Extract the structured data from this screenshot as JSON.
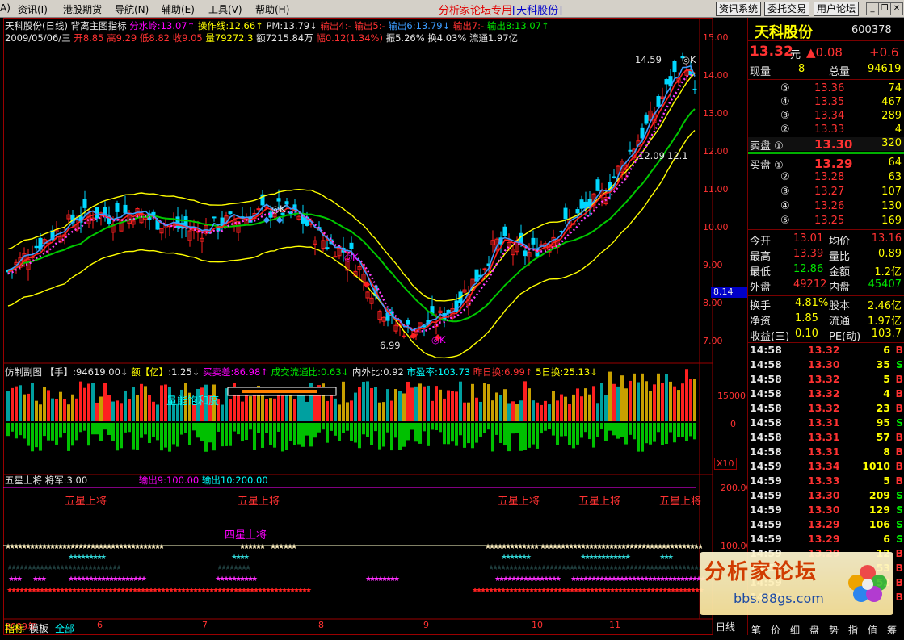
{
  "menu": {
    "items": [
      "A)",
      "资讯(I)",
      "港股期货",
      "导航(N)",
      "辅助(E)",
      "工具(V)",
      "帮助(H)"
    ],
    "banner_prefix": "分析家论坛专用",
    "banner_stock": "[天科股份]",
    "buttons": [
      "资讯系统",
      "委托交易",
      "用户论坛"
    ]
  },
  "header": {
    "line1_name": "天科股份(日线)",
    "line1_indicator": "背离主图指标",
    "fsl": "分水岭:13.07↑",
    "czx": "操作线:12.66↑",
    "pm": "PM:13.79↓",
    "sc4": "输出4:-",
    "sc5": "输出5:-",
    "sc6": "输出6:13.79↓",
    "sc7": "输出7:-",
    "sc8": "输出8:13.07↑",
    "line2_date": "2009/05/06/三",
    "open": "开8.85",
    "high": "高9.29",
    "low": "低8.82",
    "close": "收9.05",
    "vol": "量79272.3",
    "amt": "额7215.84万",
    "chg": "幅0.12(1.34%)",
    "amp": "振5.26%",
    "turn": "换4.03%",
    "float": "流通1.97亿"
  },
  "main_axis": [
    "15.00",
    "14.00",
    "13.00",
    "12.00",
    "11.00",
    "10.00",
    "9.00",
    "8.00",
    "7.00"
  ],
  "cursor_price": "8.14",
  "annotations": {
    "high_label": "14.59",
    "low_label": "6.99",
    "mid_label": "12.09",
    "mid_label2": "12.1",
    "ok1": "◎K",
    "ok2": "◎K",
    "ok3": "◎K",
    "ok4": "◎K"
  },
  "sub1": {
    "title": "仿制副图",
    "hand": "【手】:94619.00↓",
    "e_label": "额【亿】",
    "e_val": ":1.25↓",
    "buysell": "买卖差:86.98↑",
    "ratio": "成交流通比:0.63↓",
    "inout": "内外比:0.92",
    "pe": "市盈率:103.73",
    "prev": "昨日换:6.99↑",
    "five": "5日换:25.13↓",
    "floating": "量能饱和度",
    "axis": [
      "15000",
      "0"
    ],
    "x10": "X10"
  },
  "sub2": {
    "title": "五星上将",
    "jj": "将军:3.00",
    "o9": "输出9:100.00",
    "o10": "输出10:200.00",
    "wx": "五星上将",
    "sx": "四星上将",
    "axis": [
      "200.00",
      "100.00"
    ]
  },
  "x_axis": [
    "2009年",
    "6",
    "7",
    "8",
    "9",
    "10",
    "11"
  ],
  "day_label": "日线",
  "bottom_tabs": [
    "指标",
    "模板",
    "全部"
  ],
  "panel": {
    "name": "天科股份",
    "code": "600378",
    "price": "13.32",
    "unit": "元",
    "chg": "▲0.08",
    "chg_pct": "+0.6",
    "xl_label": "现量",
    "xl_val": "8",
    "zl_label": "总量",
    "zl_val": "94619",
    "asks": [
      {
        "lv": "⑤",
        "p": "13.36",
        "v": "74"
      },
      {
        "lv": "④",
        "p": "13.35",
        "v": "467"
      },
      {
        "lv": "③",
        "p": "13.34",
        "v": "289"
      },
      {
        "lv": "②",
        "p": "13.33",
        "v": "4"
      },
      {
        "lv": "卖盘 ①",
        "p": "13.30",
        "v": "320"
      }
    ],
    "bids": [
      {
        "lv": "买盘 ①",
        "p": "13.29",
        "v": "64"
      },
      {
        "lv": "②",
        "p": "13.28",
        "v": "63"
      },
      {
        "lv": "③",
        "p": "13.27",
        "v": "107"
      },
      {
        "lv": "④",
        "p": "13.26",
        "v": "130"
      },
      {
        "lv": "⑤",
        "p": "13.25",
        "v": "169"
      }
    ],
    "stats": [
      {
        "l1": "今开",
        "v1": "13.01",
        "l2": "均价",
        "v2": "13.16"
      },
      {
        "l1": "最高",
        "v1": "13.39",
        "l2": "量比",
        "v2": "0.89"
      },
      {
        "l1": "最低",
        "v1": "12.86",
        "l2": "金额",
        "v2": "1.2亿"
      },
      {
        "l1": "外盘",
        "v1": "49212",
        "l2": "内盘",
        "v2": "45407"
      }
    ],
    "fund": [
      {
        "l1": "换手",
        "v1": "4.81%",
        "l2": "股本",
        "v2": "2.46亿"
      },
      {
        "l1": "净资",
        "v1": "1.85",
        "l2": "流通",
        "v2": "1.97亿"
      },
      {
        "l1": "收益(三)",
        "v1": "0.10",
        "l2": "PE(动)",
        "v2": "103.7"
      }
    ],
    "ticks": [
      {
        "t": "14:58",
        "p": "13.32",
        "v": "6",
        "d": "B"
      },
      {
        "t": "14:58",
        "p": "13.30",
        "v": "35",
        "d": "S"
      },
      {
        "t": "14:58",
        "p": "13.32",
        "v": "5",
        "d": "B"
      },
      {
        "t": "14:58",
        "p": "13.32",
        "v": "4",
        "d": "B"
      },
      {
        "t": "14:58",
        "p": "13.32",
        "v": "23",
        "d": "B"
      },
      {
        "t": "14:58",
        "p": "13.31",
        "v": "95",
        "d": "S"
      },
      {
        "t": "14:58",
        "p": "13.31",
        "v": "57",
        "d": "B"
      },
      {
        "t": "14:58",
        "p": "13.31",
        "v": "8",
        "d": "B"
      },
      {
        "t": "14:59",
        "p": "13.34",
        "v": "1010",
        "d": "B"
      },
      {
        "t": "14:59",
        "p": "13.33",
        "v": "5",
        "d": "B"
      },
      {
        "t": "14:59",
        "p": "13.30",
        "v": "209",
        "d": "S"
      },
      {
        "t": "14:59",
        "p": "13.30",
        "v": "129",
        "d": "S"
      },
      {
        "t": "14:59",
        "p": "13.29",
        "v": "106",
        "d": "S"
      },
      {
        "t": "14:59",
        "p": "13.29",
        "v": "6",
        "d": "S"
      },
      {
        "t": "14:59",
        "p": "13.29",
        "v": "12",
        "d": "B"
      },
      {
        "t": "14:59",
        "p": "",
        "v": "53",
        "d": "B"
      },
      {
        "t": "14:59",
        "p": "",
        "v": "52",
        "d": "B"
      },
      {
        "t": "14:59",
        "p": "",
        "v": "",
        "d": "B"
      }
    ],
    "bottom_tabs": [
      "笔",
      "价",
      "细",
      "盘",
      "势",
      "指",
      "值",
      "筹"
    ]
  },
  "watermark": {
    "title": "分析家论坛",
    "url": "bbs.88gs.com"
  }
}
